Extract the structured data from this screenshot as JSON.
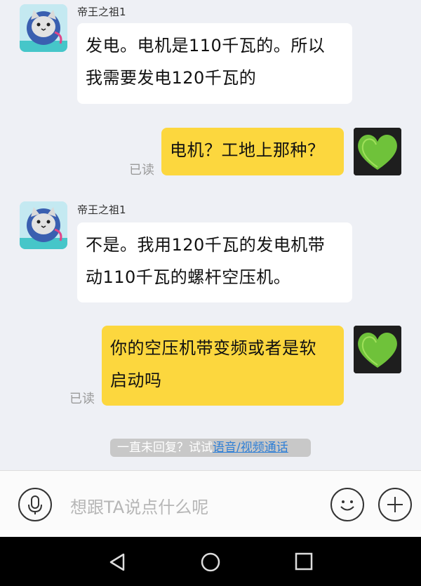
{
  "messages": [
    {
      "direction": "in",
      "sender": "帝王之祖1",
      "avatar": "cat-avatar-icon",
      "lines": [
        "发电。电机是110千瓦的。所以",
        "我需要发电120千瓦的"
      ]
    },
    {
      "direction": "out",
      "status": "已读",
      "avatar": "green-heart-avatar-icon",
      "lines": [
        "电机？工地上那种？"
      ]
    },
    {
      "direction": "in",
      "sender": "帝王之祖1",
      "avatar": "cat-avatar-icon",
      "lines": [
        "不是。我用120千瓦的发电机带",
        "动110千瓦的螺杆空压机。"
      ]
    },
    {
      "direction": "out",
      "status": "已读",
      "avatar": "green-heart-avatar-icon",
      "lines": [
        "你的空压机带变频或者是软",
        "启动吗"
      ]
    }
  ],
  "hint": {
    "text": "一直未回复？试试",
    "link": "语音/视频通话"
  },
  "input": {
    "placeholder": "想跟TA说点什么呢",
    "voice_icon": "microphone-icon",
    "emoji_icon": "smiley-icon",
    "more_icon": "plus-icon"
  },
  "nav": {
    "back_icon": "back-triangle-icon",
    "home_icon": "home-circle-icon",
    "recents_icon": "recents-square-icon"
  },
  "colors": {
    "background": "#eef0f5",
    "outgoing_bubble": "#fcd73e",
    "incoming_bubble": "#ffffff",
    "link": "#2f7fd6"
  }
}
